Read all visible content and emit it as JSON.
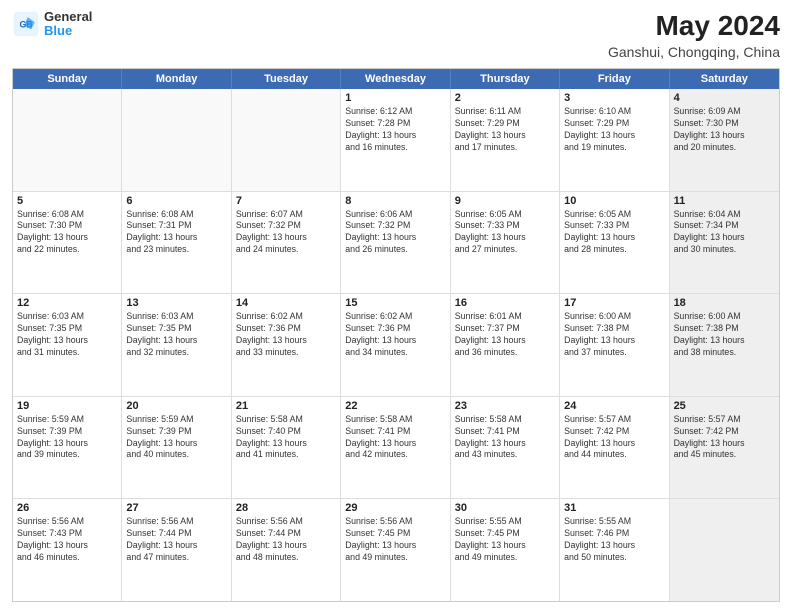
{
  "header": {
    "logo_line1": "General",
    "logo_line2": "Blue",
    "main_title": "May 2024",
    "sub_title": "Ganshui, Chongqing, China"
  },
  "calendar": {
    "days_of_week": [
      "Sunday",
      "Monday",
      "Tuesday",
      "Wednesday",
      "Thursday",
      "Friday",
      "Saturday"
    ],
    "rows": [
      [
        {
          "day": "",
          "info": "",
          "shaded": false,
          "empty": true
        },
        {
          "day": "",
          "info": "",
          "shaded": false,
          "empty": true
        },
        {
          "day": "",
          "info": "",
          "shaded": false,
          "empty": true
        },
        {
          "day": "1",
          "info": "Sunrise: 6:12 AM\nSunset: 7:28 PM\nDaylight: 13 hours\nand 16 minutes.",
          "shaded": false,
          "empty": false
        },
        {
          "day": "2",
          "info": "Sunrise: 6:11 AM\nSunset: 7:29 PM\nDaylight: 13 hours\nand 17 minutes.",
          "shaded": false,
          "empty": false
        },
        {
          "day": "3",
          "info": "Sunrise: 6:10 AM\nSunset: 7:29 PM\nDaylight: 13 hours\nand 19 minutes.",
          "shaded": false,
          "empty": false
        },
        {
          "day": "4",
          "info": "Sunrise: 6:09 AM\nSunset: 7:30 PM\nDaylight: 13 hours\nand 20 minutes.",
          "shaded": true,
          "empty": false
        }
      ],
      [
        {
          "day": "5",
          "info": "Sunrise: 6:08 AM\nSunset: 7:30 PM\nDaylight: 13 hours\nand 22 minutes.",
          "shaded": false,
          "empty": false
        },
        {
          "day": "6",
          "info": "Sunrise: 6:08 AM\nSunset: 7:31 PM\nDaylight: 13 hours\nand 23 minutes.",
          "shaded": false,
          "empty": false
        },
        {
          "day": "7",
          "info": "Sunrise: 6:07 AM\nSunset: 7:32 PM\nDaylight: 13 hours\nand 24 minutes.",
          "shaded": false,
          "empty": false
        },
        {
          "day": "8",
          "info": "Sunrise: 6:06 AM\nSunset: 7:32 PM\nDaylight: 13 hours\nand 26 minutes.",
          "shaded": false,
          "empty": false
        },
        {
          "day": "9",
          "info": "Sunrise: 6:05 AM\nSunset: 7:33 PM\nDaylight: 13 hours\nand 27 minutes.",
          "shaded": false,
          "empty": false
        },
        {
          "day": "10",
          "info": "Sunrise: 6:05 AM\nSunset: 7:33 PM\nDaylight: 13 hours\nand 28 minutes.",
          "shaded": false,
          "empty": false
        },
        {
          "day": "11",
          "info": "Sunrise: 6:04 AM\nSunset: 7:34 PM\nDaylight: 13 hours\nand 30 minutes.",
          "shaded": true,
          "empty": false
        }
      ],
      [
        {
          "day": "12",
          "info": "Sunrise: 6:03 AM\nSunset: 7:35 PM\nDaylight: 13 hours\nand 31 minutes.",
          "shaded": false,
          "empty": false
        },
        {
          "day": "13",
          "info": "Sunrise: 6:03 AM\nSunset: 7:35 PM\nDaylight: 13 hours\nand 32 minutes.",
          "shaded": false,
          "empty": false
        },
        {
          "day": "14",
          "info": "Sunrise: 6:02 AM\nSunset: 7:36 PM\nDaylight: 13 hours\nand 33 minutes.",
          "shaded": false,
          "empty": false
        },
        {
          "day": "15",
          "info": "Sunrise: 6:02 AM\nSunset: 7:36 PM\nDaylight: 13 hours\nand 34 minutes.",
          "shaded": false,
          "empty": false
        },
        {
          "day": "16",
          "info": "Sunrise: 6:01 AM\nSunset: 7:37 PM\nDaylight: 13 hours\nand 36 minutes.",
          "shaded": false,
          "empty": false
        },
        {
          "day": "17",
          "info": "Sunrise: 6:00 AM\nSunset: 7:38 PM\nDaylight: 13 hours\nand 37 minutes.",
          "shaded": false,
          "empty": false
        },
        {
          "day": "18",
          "info": "Sunrise: 6:00 AM\nSunset: 7:38 PM\nDaylight: 13 hours\nand 38 minutes.",
          "shaded": true,
          "empty": false
        }
      ],
      [
        {
          "day": "19",
          "info": "Sunrise: 5:59 AM\nSunset: 7:39 PM\nDaylight: 13 hours\nand 39 minutes.",
          "shaded": false,
          "empty": false
        },
        {
          "day": "20",
          "info": "Sunrise: 5:59 AM\nSunset: 7:39 PM\nDaylight: 13 hours\nand 40 minutes.",
          "shaded": false,
          "empty": false
        },
        {
          "day": "21",
          "info": "Sunrise: 5:58 AM\nSunset: 7:40 PM\nDaylight: 13 hours\nand 41 minutes.",
          "shaded": false,
          "empty": false
        },
        {
          "day": "22",
          "info": "Sunrise: 5:58 AM\nSunset: 7:41 PM\nDaylight: 13 hours\nand 42 minutes.",
          "shaded": false,
          "empty": false
        },
        {
          "day": "23",
          "info": "Sunrise: 5:58 AM\nSunset: 7:41 PM\nDaylight: 13 hours\nand 43 minutes.",
          "shaded": false,
          "empty": false
        },
        {
          "day": "24",
          "info": "Sunrise: 5:57 AM\nSunset: 7:42 PM\nDaylight: 13 hours\nand 44 minutes.",
          "shaded": false,
          "empty": false
        },
        {
          "day": "25",
          "info": "Sunrise: 5:57 AM\nSunset: 7:42 PM\nDaylight: 13 hours\nand 45 minutes.",
          "shaded": true,
          "empty": false
        }
      ],
      [
        {
          "day": "26",
          "info": "Sunrise: 5:56 AM\nSunset: 7:43 PM\nDaylight: 13 hours\nand 46 minutes.",
          "shaded": false,
          "empty": false
        },
        {
          "day": "27",
          "info": "Sunrise: 5:56 AM\nSunset: 7:44 PM\nDaylight: 13 hours\nand 47 minutes.",
          "shaded": false,
          "empty": false
        },
        {
          "day": "28",
          "info": "Sunrise: 5:56 AM\nSunset: 7:44 PM\nDaylight: 13 hours\nand 48 minutes.",
          "shaded": false,
          "empty": false
        },
        {
          "day": "29",
          "info": "Sunrise: 5:56 AM\nSunset: 7:45 PM\nDaylight: 13 hours\nand 49 minutes.",
          "shaded": false,
          "empty": false
        },
        {
          "day": "30",
          "info": "Sunrise: 5:55 AM\nSunset: 7:45 PM\nDaylight: 13 hours\nand 49 minutes.",
          "shaded": false,
          "empty": false
        },
        {
          "day": "31",
          "info": "Sunrise: 5:55 AM\nSunset: 7:46 PM\nDaylight: 13 hours\nand 50 minutes.",
          "shaded": false,
          "empty": false
        },
        {
          "day": "",
          "info": "",
          "shaded": true,
          "empty": true
        }
      ]
    ]
  }
}
